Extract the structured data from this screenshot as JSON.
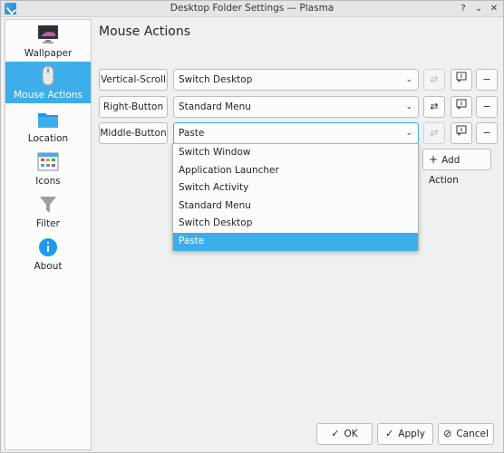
{
  "window": {
    "title": "Desktop Folder Settings — Plasma"
  },
  "titlebar": {
    "help_glyph": "?",
    "minimize_glyph": "⌄",
    "close_glyph": "✕"
  },
  "sidebar": {
    "items": [
      {
        "label": "Wallpaper",
        "icon": "monitor-icon"
      },
      {
        "label": "Mouse Actions",
        "icon": "mouse-icon",
        "active": true
      },
      {
        "label": "Location",
        "icon": "folder-icon"
      },
      {
        "label": "Icons",
        "icon": "icons-grid-icon"
      },
      {
        "label": "Filter",
        "icon": "funnel-icon"
      },
      {
        "label": "About",
        "icon": "info-icon"
      }
    ]
  },
  "main": {
    "title": "Mouse Actions",
    "rows": [
      {
        "trigger": "Vertical-Scroll",
        "action": "Switch Desktop",
        "configure_enabled": false
      },
      {
        "trigger": "Right-Button",
        "action": "Standard Menu",
        "configure_enabled": true
      },
      {
        "trigger": "Middle-Button",
        "action": "Paste",
        "configure_enabled": false
      }
    ],
    "add_action_label": "Add Action",
    "dropdown_options": [
      "Switch Window",
      "Application Launcher",
      "Switch Activity",
      "Standard Menu",
      "Switch Desktop",
      "Paste"
    ],
    "dropdown_selected": "Paste"
  },
  "footer": {
    "ok_label": "OK",
    "apply_label": "Apply",
    "cancel_label": "Cancel"
  },
  "colors": {
    "accent": "#3daee9",
    "window_bg": "#eff0f1",
    "sidebar_bg": "#fcfcfc"
  }
}
